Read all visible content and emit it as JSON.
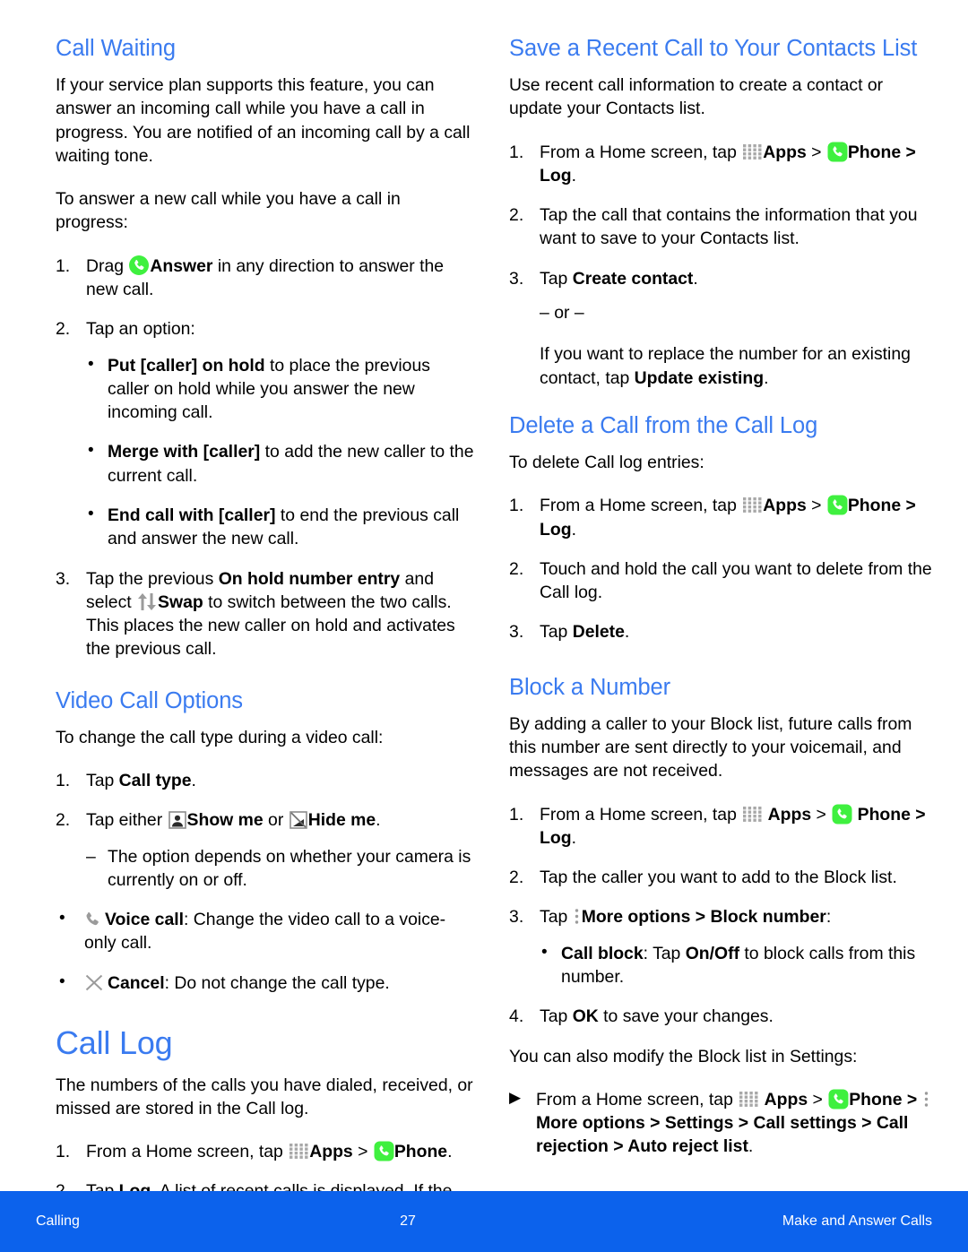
{
  "page": {
    "number": "27",
    "footer_left": "Calling",
    "footer_right": "Make and Answer Calls",
    "accent_heading_color": "#3a7bf0",
    "footer_bar_color": "#0c62ec",
    "phone_icon_green": "#3ff03f"
  },
  "icons": {
    "apps": "apps-grid-icon",
    "phone": "phone-icon",
    "answer": "answer-call-icon",
    "swap": "swap-icon",
    "show_me": "show-me-icon",
    "hide_me": "hide-me-icon",
    "voice_call": "voice-call-icon",
    "cancel": "cancel-icon",
    "more_options": "more-options-icon"
  },
  "left_column": {
    "call_waiting": {
      "heading": "Call Waiting",
      "intro": "If your service plan supports this feature, you can answer an incoming call while you have a call in progress. You are notified of an incoming call by a call waiting tone.",
      "lead_in": "To answer a new call while you have a call in progress:",
      "step1_num": "1.",
      "step1_pre": "Drag ",
      "step1_bold": "Answer",
      "step1_post": " in any direction to answer the new call.",
      "step2_num": "2.",
      "step2_text": "Tap an option:",
      "option1_bold": "Put [caller] on hold",
      "option1_text": " to place the previous caller on hold while you answer the new incoming call.",
      "option2_bold": "Merge with [caller]",
      "option2_text": " to add the new caller to the current call.",
      "option3_bold": "End call with [caller]",
      "option3_text": " to end the previous call and answer the new call.",
      "step3_num": "3.",
      "step3_pre": "Tap the previous ",
      "step3_bold1": "On hold number entry",
      "step3_mid": " and select ",
      "step3_bold2": "Swap",
      "step3_post": " to switch between the two calls. This places the new caller on hold and activates the previous call."
    },
    "video_call_options": {
      "heading": "Video Call Options",
      "intro": "To change the call type during a video call:",
      "step1_num": "1.",
      "step1_pre": "Tap ",
      "step1_bold": "Call type",
      "step1_post": ".",
      "step2_num": "2.",
      "step2_pre": "Tap either ",
      "step2_bold1": "Show me",
      "step2_mid": " or ",
      "step2_bold2": "Hide me",
      "step2_post": ".",
      "dash_note": "The option depends on whether your camera is currently on or off.",
      "voice_bold": "Voice call",
      "voice_text": ": Change the video call to a voice-only call.",
      "cancel_bold": "Cancel",
      "cancel_text": ": Do not change the call type."
    },
    "call_log": {
      "heading": "Call Log",
      "intro": "The numbers of the calls you have dialed, received, or missed are stored in the Call log.",
      "step1_num": "1.",
      "step1_pre": "From a Home screen, tap ",
      "step1_apps": "Apps",
      "step1_gt": " > ",
      "step1_phone": "Phone",
      "step1_post": ".",
      "step2_num": "2.",
      "step2_pre": "Tap ",
      "step2_bold": "Log",
      "step2_post": ". A list of recent calls is displayed. If the caller is in your Contacts list, the caller's name is displayed."
    }
  },
  "right_column": {
    "save_recent_call": {
      "heading": "Save a Recent Call to Your Contacts List",
      "intro": "Use recent call information to create a contact or update your Contacts list.",
      "step1_num": "1.",
      "step1_pre": "From a Home screen, tap ",
      "step1_apps": "Apps",
      "step1_gt": " > ",
      "step1_phone": "Phone",
      "step1_tail": " > Log",
      "step1_post": ".",
      "step2_num": "2.",
      "step2_text": "Tap the call that contains the information that you want to save to your Contacts list.",
      "step3_num": "3.",
      "step3_pre": "Tap ",
      "step3_bold": "Create contact",
      "step3_post": ".",
      "or_text": "– or –",
      "alt_pre": "If you want to replace the number for an existing contact, tap ",
      "alt_bold": "Update existing",
      "alt_post": "."
    },
    "delete_call": {
      "heading": "Delete a Call from the Call Log",
      "intro": "To delete Call log entries:",
      "step1_num": "1.",
      "step1_pre": "From a Home screen, tap ",
      "step1_apps": "Apps",
      "step1_gt": " > ",
      "step1_phone": "Phone",
      "step1_tail": " > Log",
      "step1_post": ".",
      "step2_num": "2.",
      "step2_text": "Touch and hold the call you want to delete from the Call log.",
      "step3_num": "3.",
      "step3_pre": "Tap ",
      "step3_bold": "Delete",
      "step3_post": "."
    },
    "block_number": {
      "heading": "Block a Number",
      "intro": "By adding a caller to your Block list, future calls from this number are sent directly to your voicemail, and messages are not received.",
      "step1_num": "1.",
      "step1_pre": "From a Home screen, tap ",
      "step1_apps": "Apps",
      "step1_gt": " > ",
      "step1_phone": "Phone",
      "step1_tail": " > Log",
      "step1_post": ".",
      "step2_num": "2.",
      "step2_text": "Tap the caller you want to add to the Block list.",
      "step3_num": "3.",
      "step3_pre": "Tap ",
      "step3_bold1": "More options",
      "step3_mid": " > ",
      "step3_bold2": "Block number",
      "step3_post": ":",
      "callblock_bold": "Call block",
      "callblock_mid": ": Tap ",
      "callblock_bold2": "On/Off",
      "callblock_post": " to block calls from this number.",
      "step4_num": "4.",
      "step4_pre": "Tap ",
      "step4_bold": "OK",
      "step4_post": " to save your changes.",
      "settings_note": "You can also modify the Block list in Settings:",
      "arrow_pre": "From a Home screen, tap ",
      "arrow_apps": "Apps",
      "arrow_gt": " > ",
      "arrow_phone": "Phone",
      "arrow_tail1": " > ",
      "arrow_more": "More options",
      "arrow_tail2": " > Settings  > Call settings > Call rejection > Auto reject list",
      "arrow_post": "."
    }
  }
}
